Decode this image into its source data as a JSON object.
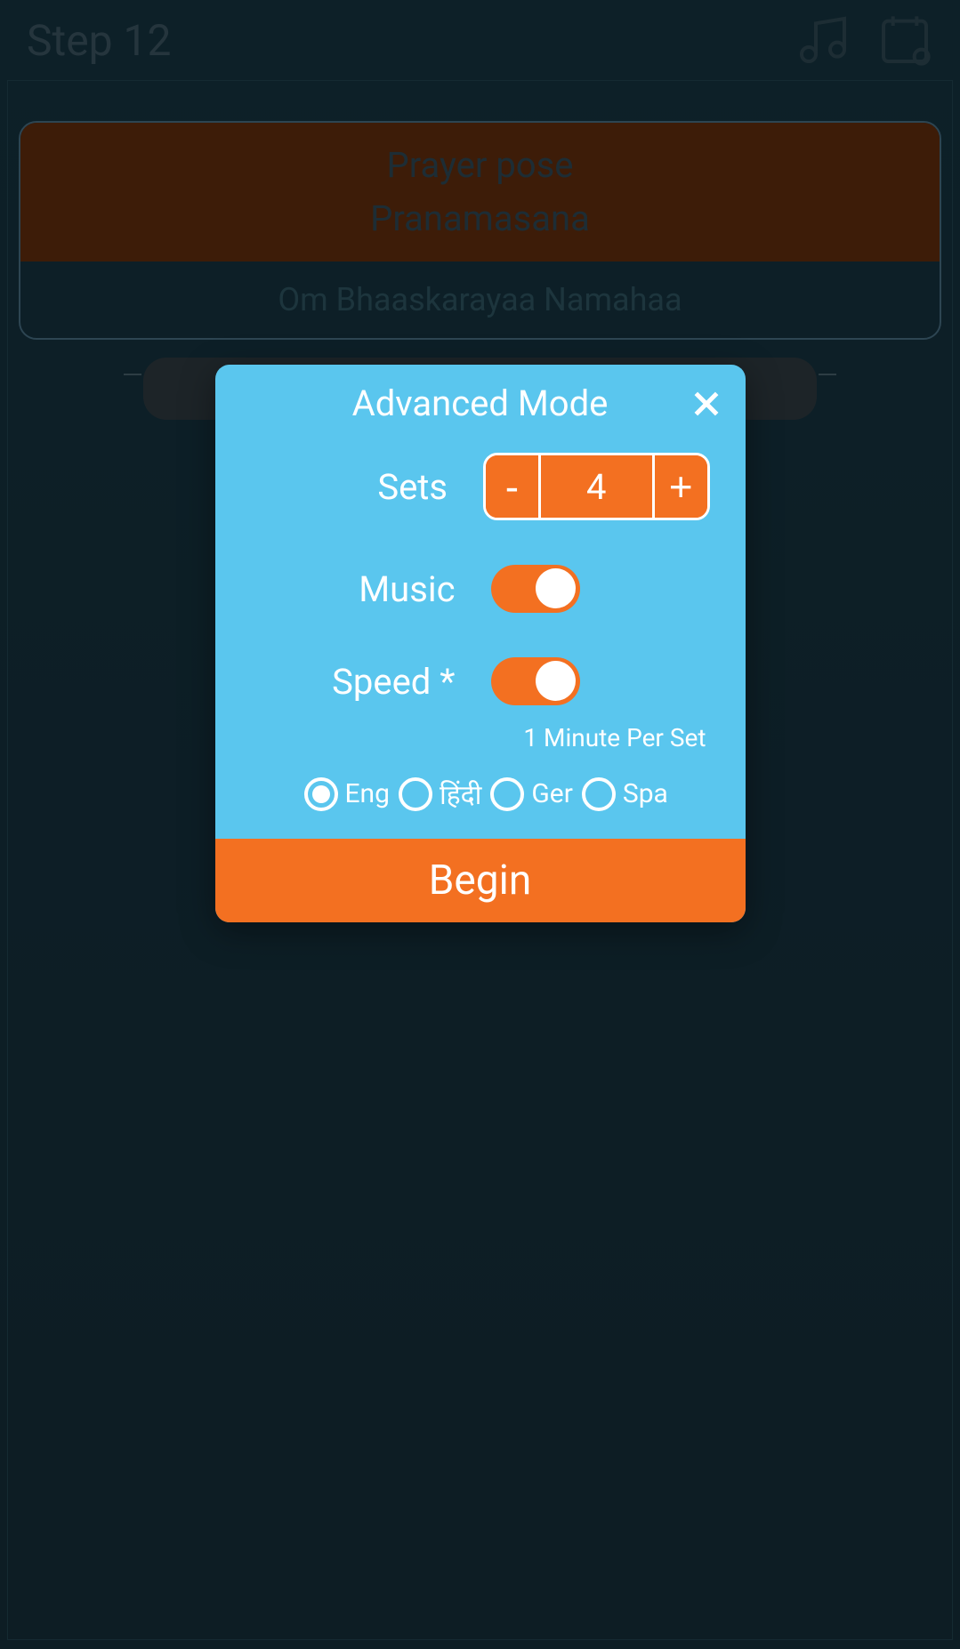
{
  "header": {
    "title": "Step 12"
  },
  "pose": {
    "title_line1": "Prayer pose",
    "title_line2": "Pranamasana",
    "mantra": "Om Bhaaskarayaa Namahaa"
  },
  "dialog": {
    "title": "Advanced Mode",
    "sets_label": "Sets",
    "sets_value": "4",
    "sets_minus": "-",
    "sets_plus": "+",
    "music_label": "Music",
    "speed_label": "Speed *",
    "speed_note": "1 Minute Per Set",
    "languages": [
      {
        "label": "Eng",
        "selected": true
      },
      {
        "label": "हिंदी",
        "selected": false
      },
      {
        "label": "Ger",
        "selected": false
      },
      {
        "label": "Spa",
        "selected": false
      }
    ],
    "begin": "Begin"
  }
}
